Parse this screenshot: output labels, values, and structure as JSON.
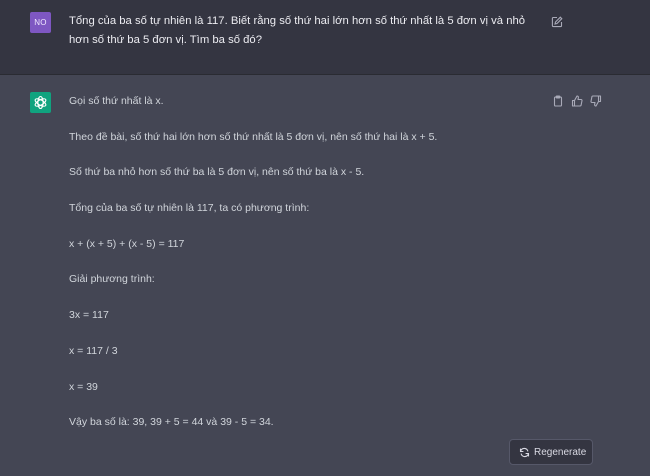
{
  "user_message": {
    "avatar_initials": "NO",
    "text": "Tổng của ba số tự nhiên là 117. Biết rằng số thứ hai lớn hơn số thứ nhất là 5 đơn vị và nhỏ hơn số thứ ba 5 đơn vị. Tìm ba số đó?",
    "edit_icon": "edit-icon"
  },
  "assistant_message": {
    "avatar_icon": "openai-logo-icon",
    "paragraphs": [
      "Gọi số thứ nhất là x.",
      "Theo đề bài, số thứ hai lớn hơn số thứ nhất là 5 đơn vị, nên số thứ hai là x + 5.",
      "Số thứ ba nhỏ hơn số thứ ba là 5 đơn vị, nên số thứ ba là x - 5.",
      "Tổng của ba số tự nhiên là 117, ta có phương trình:",
      "x + (x + 5) + (x - 5) = 117",
      "Giải phương trình:",
      "3x = 117",
      "x = 117 / 3",
      "x = 39",
      "Vậy ba số là: 39, 39 + 5 = 44 và 39 - 5 = 34."
    ],
    "action_icons": [
      "copy-icon",
      "thumbs-up-icon",
      "thumbs-down-icon"
    ]
  },
  "regenerate_button": {
    "label": "Regenerate",
    "icon": "refresh-icon"
  },
  "colors": {
    "user_background": "#343541",
    "assistant_background": "#444654",
    "user_avatar": "#7e57c2",
    "assistant_avatar": "#10a37f"
  }
}
